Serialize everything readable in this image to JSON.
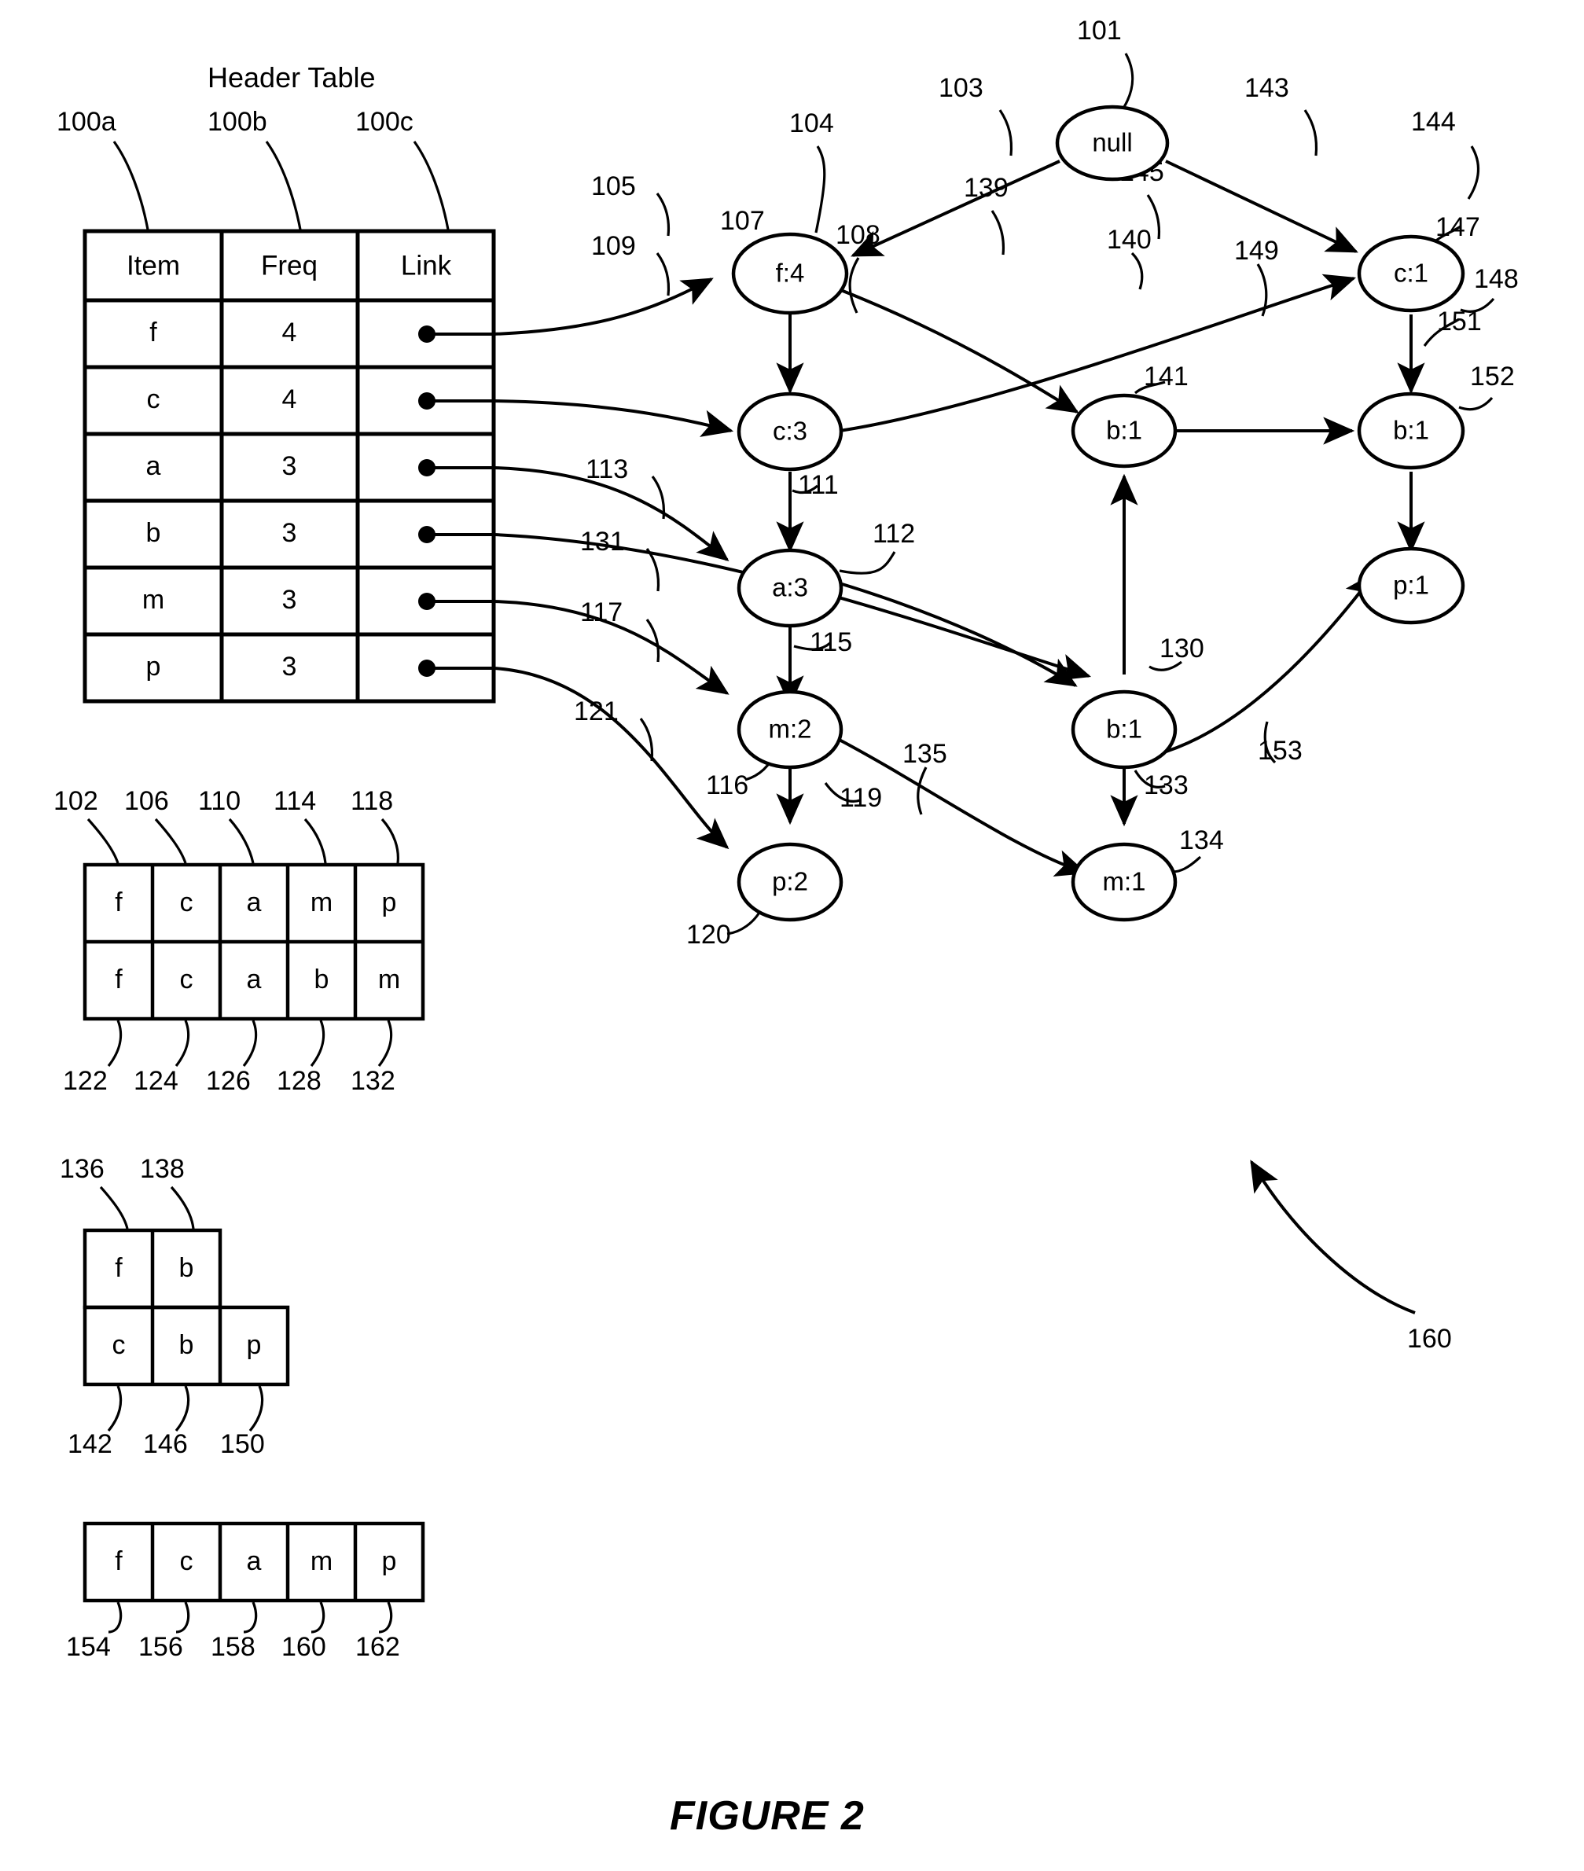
{
  "figure": {
    "caption": "FIGURE 2",
    "header_table_title": "Header Table"
  },
  "header_table": {
    "column_refs": [
      "100a",
      "100b",
      "100c"
    ],
    "columns": [
      "Item",
      "Freq",
      "Link"
    ],
    "rows": [
      {
        "item": "f",
        "freq": "4",
        "link_ref": "105"
      },
      {
        "item": "c",
        "freq": "4",
        "link_ref": "109"
      },
      {
        "item": "a",
        "freq": "3",
        "link_ref": "113"
      },
      {
        "item": "b",
        "freq": "3",
        "link_ref": "131"
      },
      {
        "item": "m",
        "freq": "3",
        "link_ref": "117"
      },
      {
        "item": "p",
        "freq": "3",
        "link_ref": "121"
      }
    ]
  },
  "tree": {
    "nodes": [
      {
        "id": "root",
        "label": "null",
        "ref": "101"
      },
      {
        "id": "f4",
        "label": "f:4",
        "ref": "104"
      },
      {
        "id": "c3",
        "label": "c:3",
        "ref": "108"
      },
      {
        "id": "a3",
        "label": "a:3",
        "ref": "112"
      },
      {
        "id": "m2",
        "label": "m:2",
        "ref": "116"
      },
      {
        "id": "p2",
        "label": "p:2",
        "ref": "120"
      },
      {
        "id": "b1mid",
        "label": "b:1",
        "ref": "130"
      },
      {
        "id": "m1",
        "label": "m:1",
        "ref": "134"
      },
      {
        "id": "b1top",
        "label": "b:1",
        "ref": "140"
      },
      {
        "id": "c1",
        "label": "c:1",
        "ref": "144"
      },
      {
        "id": "b1r",
        "label": "b:1",
        "ref": "148"
      },
      {
        "id": "p1",
        "label": "p:1",
        "ref": "152"
      }
    ],
    "edge_refs": [
      "103",
      "105",
      "107",
      "109",
      "111",
      "113",
      "115",
      "117",
      "119",
      "121",
      "131",
      "133",
      "135",
      "139",
      "141",
      "143",
      "145",
      "147",
      "149",
      "151",
      "153"
    ],
    "misc_refs": [
      "160"
    ]
  },
  "transaction_table_1": {
    "top_refs": [
      "102",
      "106",
      "110",
      "114",
      "118"
    ],
    "bottom_refs": [
      "122",
      "124",
      "126",
      "128",
      "132"
    ],
    "rows": [
      [
        "f",
        "c",
        "a",
        "m",
        "p"
      ],
      [
        "f",
        "c",
        "a",
        "b",
        "m"
      ]
    ]
  },
  "transaction_table_2": {
    "top_refs": [
      "136",
      "138"
    ],
    "bottom_refs": [
      "142",
      "146",
      "150"
    ],
    "rows": [
      [
        "f",
        "b"
      ],
      [
        "c",
        "b",
        "p"
      ]
    ]
  },
  "transaction_table_3": {
    "bottom_refs": [
      "154",
      "156",
      "158",
      "160",
      "162"
    ],
    "rows": [
      [
        "f",
        "c",
        "a",
        "m",
        "p"
      ]
    ]
  }
}
